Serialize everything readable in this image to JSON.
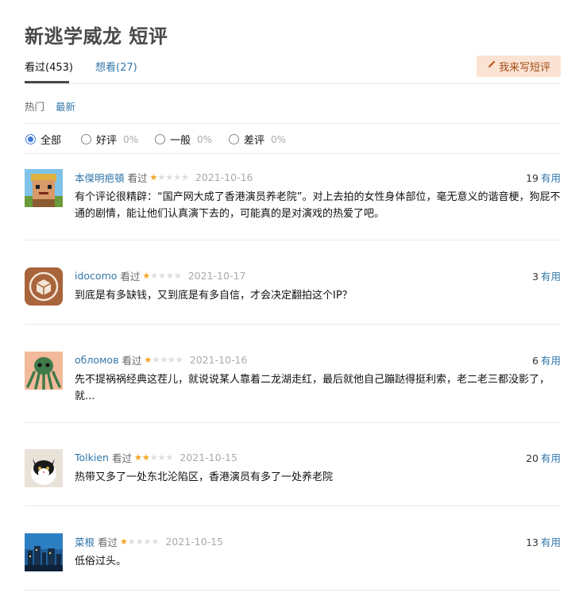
{
  "page": {
    "title": "新逃学威龙 短评"
  },
  "tabs": {
    "watched": "看过(453)",
    "want": "想看(27)",
    "write_button": "我来写短评"
  },
  "sort": {
    "hot": "热门",
    "latest": "最新"
  },
  "filters": {
    "all": {
      "label": "全部",
      "selected": true
    },
    "good": {
      "label": "好评",
      "pct": "0%"
    },
    "mid": {
      "label": "一般",
      "pct": "0%"
    },
    "bad": {
      "label": "差评",
      "pct": "0%"
    }
  },
  "colors": {
    "link": "#3377aa",
    "star": "#f5a623",
    "write_bg": "#fbe3d3",
    "write_text": "#a44d18"
  },
  "comments": [
    {
      "user": "本傑明疤頓",
      "status": "看过",
      "rating": 1,
      "date": "2021-10-16",
      "votes": "19",
      "useful": "有用",
      "text": "有个评论很精辟：“国产网大成了香港演员养老院”。对上去拍的女性身体部位，毫无意义的谐音梗，狗屁不通的剧情，能让他们认真演下去的，可能真的是对演戏的热爱了吧。",
      "avatar": "pixel-character-avatar"
    },
    {
      "user": "idocomo",
      "status": "看过",
      "rating": 1,
      "date": "2021-10-17",
      "votes": "3",
      "useful": "有用",
      "text": "到底是有多缺钱，又到底是有多自信，才会决定翻拍这个IP？",
      "avatar": "box-icon-avatar"
    },
    {
      "user": "обломов",
      "status": "看过",
      "rating": 1,
      "date": "2021-10-16",
      "votes": "6",
      "useful": "有用",
      "text": "先不提祸祸经典这茬儿，就说说某人靠着二龙湖走红，最后就他自己蹦跶得挺利索，老二老三都没影了，就...",
      "avatar": "octopus-avatar"
    },
    {
      "user": "Tolkien",
      "status": "看过",
      "rating": 2,
      "date": "2021-10-15",
      "votes": "20",
      "useful": "有用",
      "text": "热带又多了一处东北沦陷区，香港演员有多了一处养老院",
      "avatar": "cat-avatar"
    },
    {
      "user": "菜根",
      "status": "看过",
      "rating": 1,
      "date": "2021-10-15",
      "votes": "13",
      "useful": "有用",
      "text": "低俗过头。",
      "avatar": "city-night-avatar"
    }
  ],
  "star_glyphs": "★★★★★"
}
